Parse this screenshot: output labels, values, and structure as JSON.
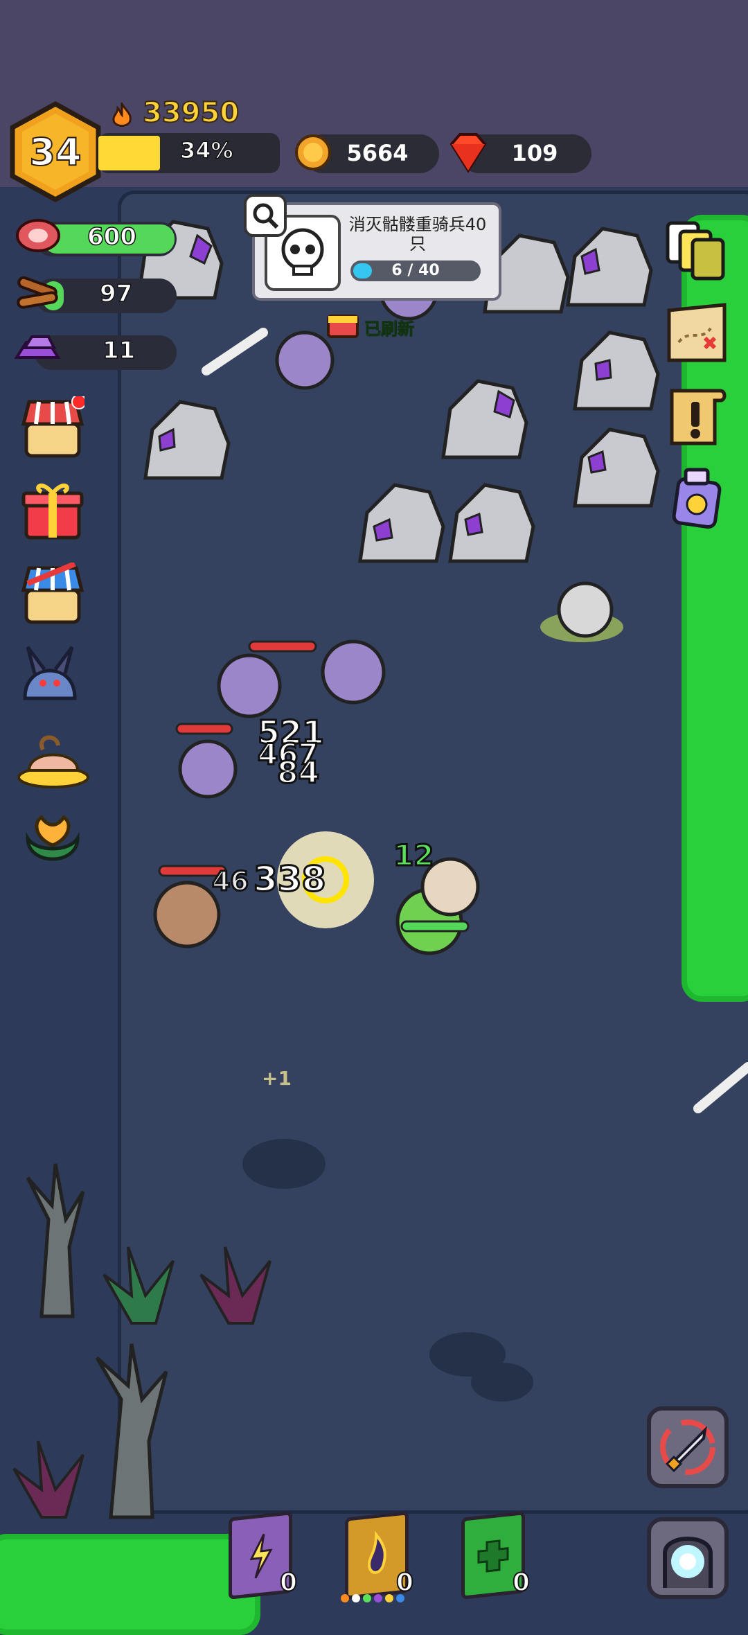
{
  "header": {
    "level": "34",
    "xp_total": "33950",
    "xp_percent_label": "34%",
    "xp_progress": 0.34,
    "coins": "5664",
    "gems": "109"
  },
  "resources": [
    {
      "name": "meat",
      "value": "600"
    },
    {
      "name": "wood",
      "value": "97"
    },
    {
      "name": "crystal",
      "value": "11"
    }
  ],
  "quest": {
    "title": "消灭骷髅重骑兵40只",
    "progress_label": "6 / 40",
    "progress_fraction": 0.15,
    "refreshed_label": "已刷新"
  },
  "left_buttons": [
    "shop-icon",
    "gift-icon",
    "sale-shop-icon",
    "dragon-icon",
    "treasure-icon",
    "flower-icon"
  ],
  "right_buttons": [
    "cards-icon",
    "map-icon",
    "quest-scroll-icon",
    "potion-icon"
  ],
  "damage_numbers": [
    "521",
    "467",
    "84",
    "338",
    "46",
    "12"
  ],
  "floating_text": "+1",
  "books": [
    {
      "name": "lightning-book",
      "count": "0",
      "color": "#8a5fb8"
    },
    {
      "name": "fire-book",
      "count": "0",
      "color": "#d39a2a"
    },
    {
      "name": "heal-book",
      "count": "0",
      "color": "#2fae3e"
    }
  ],
  "colors": {
    "accent_gold": "#ffd23a",
    "xp_fill": "#ffd936",
    "grass": "#29d03c",
    "hp_bar": "#e03a3a"
  }
}
